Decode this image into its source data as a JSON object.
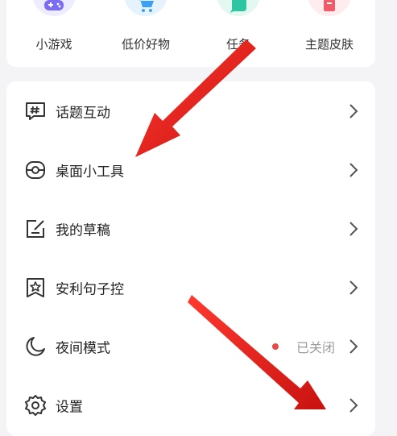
{
  "quick_grid": [
    {
      "label": "小游戏",
      "icon": "gamepad-icon",
      "color": "#7b6cf6",
      "bg": "#eeecff"
    },
    {
      "label": "低价好物",
      "icon": "shopping-cart-icon",
      "color": "#3aa0f4",
      "bg": "#e6f3ff"
    },
    {
      "label": "任务",
      "icon": "task-icon",
      "color": "#2ec6a2",
      "bg": "#e4f8f2"
    },
    {
      "label": "主题皮肤",
      "icon": "theme-skin-icon",
      "color": "#f05b6a",
      "bg": "#ffecee"
    }
  ],
  "menu": {
    "items": [
      {
        "label": "话题互动",
        "icon": "hashtag-icon"
      },
      {
        "label": "桌面小工具",
        "icon": "widget-icon"
      },
      {
        "label": "我的草稿",
        "icon": "draft-icon"
      },
      {
        "label": "安利句子控",
        "icon": "star-bookmark-icon"
      },
      {
        "label": "夜间模式",
        "icon": "moon-icon",
        "status": "已关闭"
      },
      {
        "label": "设置",
        "icon": "gear-icon"
      }
    ]
  },
  "annotation": {
    "arrow_color": "#e8201d"
  }
}
